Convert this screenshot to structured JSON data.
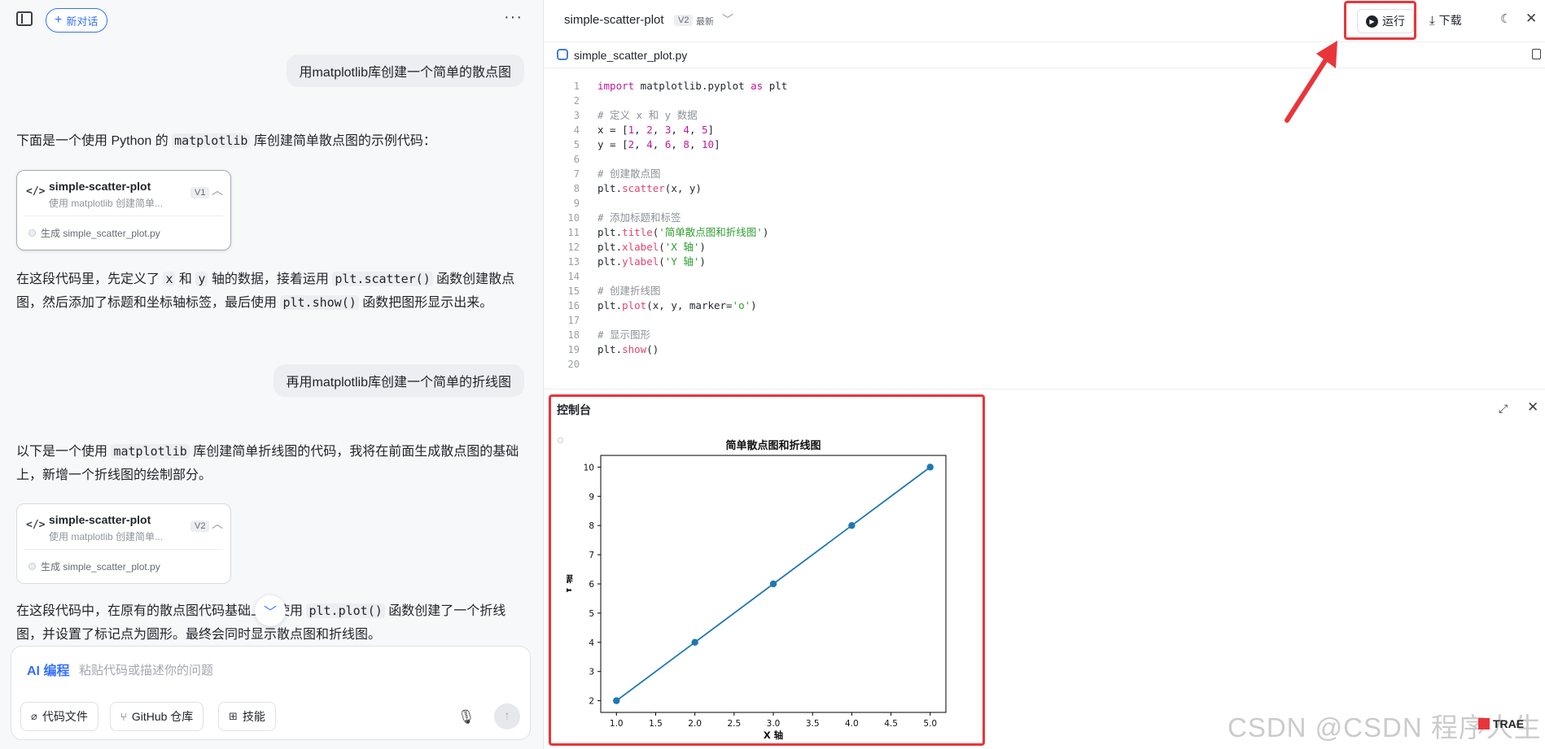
{
  "left": {
    "new_chat": "新对话",
    "more": "···",
    "messages": [
      {
        "role": "user",
        "text": "用matplotlib库创建一个简单的散点图"
      },
      {
        "role": "assistant",
        "intro_pre": "下面是一个使用 Python 的 ",
        "intro_code": "matplotlib",
        "intro_post": " 库创建简单散点图的示例代码：",
        "card": {
          "title": "simple-scatter-plot",
          "sub": "使用 matplotlib 创建简单...",
          "version": "V1",
          "foot": "生成 simple_scatter_plot.py"
        },
        "out_1": "在这段代码里，先定义了 ",
        "out_x": "x",
        "out_2": " 和 ",
        "out_y": "y",
        "out_3": " 轴的数据，接着运用 ",
        "out_c1": "plt.scatter()",
        "out_4": " 函数创建散点图，然后添加了标题和坐标轴标签，最后使用 ",
        "out_c2": "plt.show()",
        "out_5": " 函数把图形显示出来。"
      },
      {
        "role": "user",
        "text": "再用matplotlib库创建一个简单的折线图"
      },
      {
        "role": "assistant",
        "intro_pre": "以下是一个使用 ",
        "intro_code": "matplotlib",
        "intro_post": " 库创建简单折线图的代码，我将在前面生成散点图的基础上，新增一个折线图的绘制部分。",
        "card": {
          "title": "simple-scatter-plot",
          "sub": "使用 matplotlib 创建简单...",
          "version": "V2",
          "foot": "生成 simple_scatter_plot.py"
        },
        "out_1": "在这段代码中，在原有的散点图代码基础上，使用 ",
        "out_c1": "plt.plot()",
        "out_2": " 函数创建了一个折线图，并设置了标记点为圆形。最终会同时显示散点图和折线图。"
      }
    ],
    "input": {
      "label": "AI 编程",
      "placeholder": "粘贴代码或描述你的问题",
      "chips": [
        "代码文件",
        "GitHub 仓库",
        "技能"
      ]
    }
  },
  "right": {
    "project": "simple-scatter-plot",
    "version": "V2",
    "latest": "最新",
    "run": "运行",
    "download": "下载",
    "file_name": "simple_scatter_plot.py",
    "code": [
      "import matplotlib.pyplot as plt",
      "",
      "# 定义 x 和 y 数据",
      "x = [1, 2, 3, 4, 5]",
      "y = [2, 4, 6, 8, 10]",
      "",
      "# 创建散点图",
      "plt.scatter(x, y)",
      "",
      "# 添加标题和标签",
      "plt.title('简单散点图和折线图')",
      "plt.xlabel('X 轴')",
      "plt.ylabel('Y 轴')",
      "",
      "# 创建折线图",
      "plt.plot(x, y, marker='o')",
      "",
      "# 显示图形",
      "plt.show()",
      ""
    ],
    "console_title": "控制台"
  },
  "chart_data": {
    "type": "line",
    "title": "简单散点图和折线图",
    "xlabel": "X 轴",
    "ylabel": "Y 轴",
    "x": [
      1,
      2,
      3,
      4,
      5
    ],
    "y": [
      2,
      4,
      6,
      8,
      10
    ],
    "xticks": [
      "1.0",
      "1.5",
      "2.0",
      "2.5",
      "3.0",
      "3.5",
      "4.0",
      "4.5",
      "5.0"
    ],
    "yticks": [
      "2",
      "3",
      "4",
      "5",
      "6",
      "7",
      "8",
      "9",
      "10"
    ],
    "xlim": [
      0.8,
      5.2
    ],
    "ylim": [
      1.6,
      10.4
    ],
    "marker": "o",
    "color": "#1f77b4",
    "grid": false
  },
  "watermark": "CSDN @CSDN 程序人生",
  "watermark_badge": "TRAE",
  "colors": {
    "accent": "#3370ff",
    "highlight": "#e9353a"
  }
}
